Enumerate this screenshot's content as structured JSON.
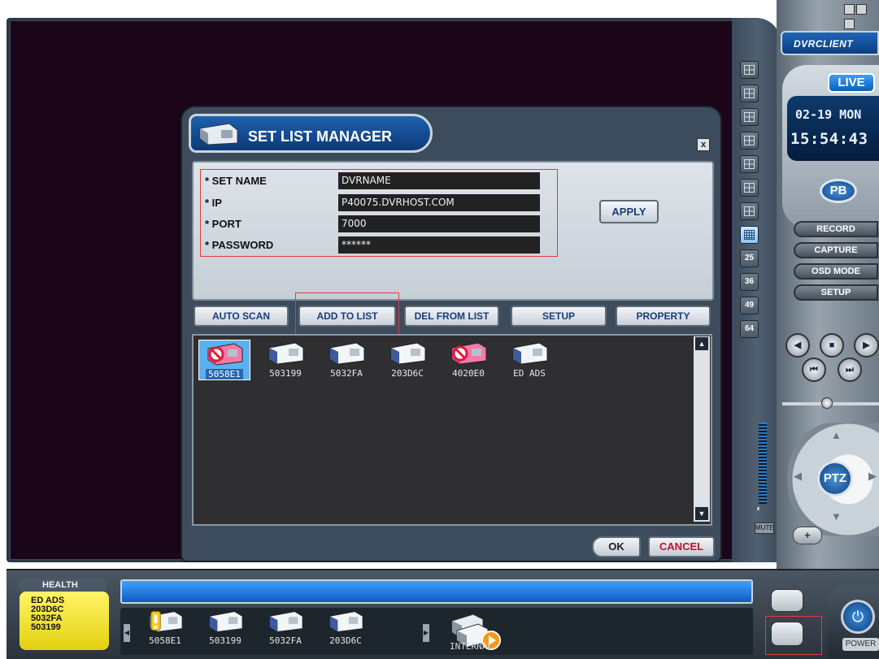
{
  "app": {
    "client_name": "DVRCLIENT",
    "mode": "LIVE",
    "date": "02-19 MON",
    "time": "15:54:43",
    "pb_label": "PB",
    "power_label": "POWER",
    "mute_label": "MUTE"
  },
  "right_panel": {
    "buttons": [
      "RECORD",
      "CAPTURE",
      "OSD MODE",
      "SETUP"
    ],
    "ptz_label": "PTZ"
  },
  "layout_buttons": [
    "",
    "",
    "",
    "",
    "",
    "",
    "",
    "",
    "25",
    "36",
    "49",
    "64"
  ],
  "dialog": {
    "title": "SET LIST MANAGER",
    "close_glyph": "x",
    "fields": [
      {
        "label": "* SET NAME",
        "value": "DVRNAME"
      },
      {
        "label": "* IP",
        "value": "P40075.DVRHOST.COM"
      },
      {
        "label": "* PORT",
        "value": "7000"
      },
      {
        "label": "* PASSWORD",
        "value": "******"
      }
    ],
    "apply_label": "APPLY",
    "toolbar": [
      "AUTO SCAN",
      "ADD TO LIST",
      "DEL FROM LIST",
      "SETUP",
      "PROPERTY"
    ],
    "devices": [
      {
        "name": "5058E1",
        "status": "error",
        "selected": true
      },
      {
        "name": "503199",
        "status": "ok",
        "selected": false
      },
      {
        "name": "5032FA",
        "status": "ok",
        "selected": false
      },
      {
        "name": "203D6C",
        "status": "ok",
        "selected": false
      },
      {
        "name": "4020E0",
        "status": "error",
        "selected": false
      },
      {
        "name": "ED ADS",
        "status": "ok",
        "selected": false
      }
    ],
    "ok_label": "OK",
    "cancel_label": "CANCEL"
  },
  "bottom": {
    "health_label": "HEALTH",
    "health_items": [
      "ED ADS",
      "203D6C",
      "5032FA",
      "503199"
    ],
    "tray_devices": [
      {
        "name": "5058E1",
        "status": "warning"
      },
      {
        "name": "503199",
        "status": "ok"
      },
      {
        "name": "5032FA",
        "status": "ok"
      },
      {
        "name": "203D6C",
        "status": "ok"
      }
    ],
    "internal_label": "INTERNAL"
  },
  "colors": {
    "accent_blue": "#1e60b0",
    "status_bar": "#3ea0ff",
    "highlight_outline": "#e03c3c",
    "health_yellow": "#fff566",
    "error_pink": "#f27aa8",
    "camera_blue": "#3d5b9e"
  }
}
